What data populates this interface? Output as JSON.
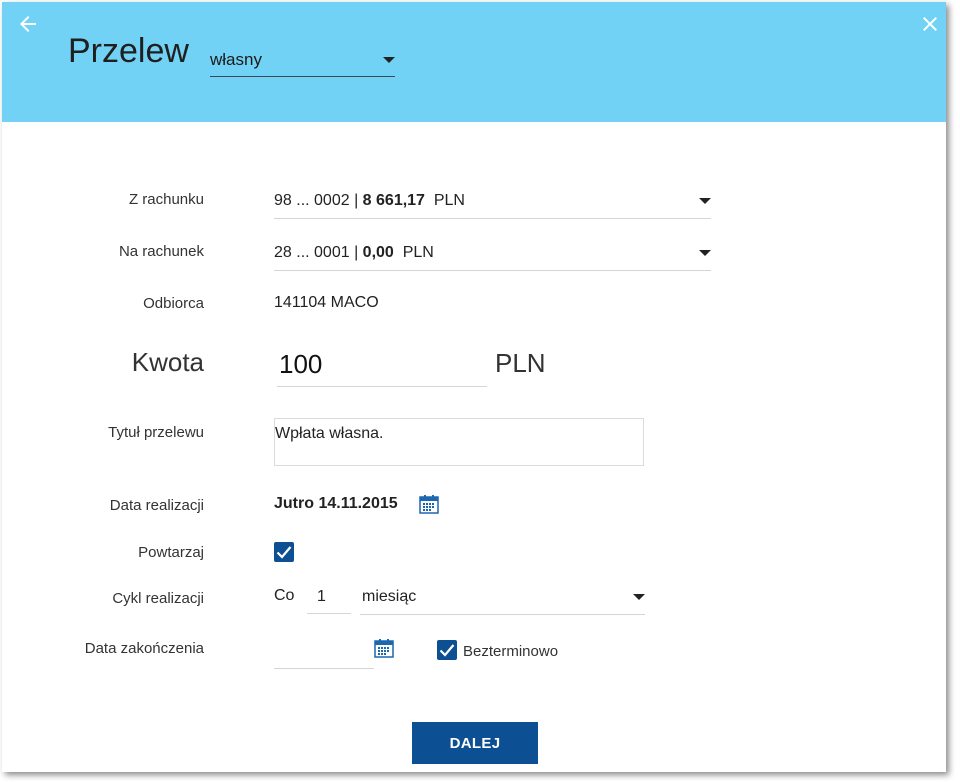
{
  "header": {
    "title": "Przelew",
    "type_value": "własny",
    "bg_color": "#71d2f5",
    "back_icon": "arrow-left-icon",
    "close_icon": "close-icon"
  },
  "form": {
    "from_account": {
      "label": "Z rachunku",
      "number": "98 ... 0002 | ",
      "balance": "8 661,17",
      "currency": "PLN"
    },
    "to_account": {
      "label": "Na rachunek",
      "number": "28 ... 0001 | ",
      "balance": "0,00",
      "currency": "PLN"
    },
    "recipient": {
      "label": "Odbiorca",
      "value": "141104 MACO"
    },
    "amount": {
      "label": "Kwota",
      "value": "100",
      "currency": "PLN"
    },
    "title_field": {
      "label": "Tytuł przelewu",
      "value": "Wpłata własna."
    },
    "execution_date": {
      "label": "Data realizacji",
      "value": "Jutro 14.11.2015"
    },
    "repeat": {
      "label": "Powtarzaj",
      "checked": true
    },
    "cycle": {
      "label": "Cykl realizacji",
      "prefix": "Co",
      "count": "1",
      "unit": "miesiąc"
    },
    "end_date": {
      "label": "Data zakończenia",
      "value": "",
      "indefinite_label": "Bezterminowo",
      "indefinite_checked": true
    }
  },
  "actions": {
    "next_label": "DALEJ",
    "accent_color": "#0d4f93"
  }
}
